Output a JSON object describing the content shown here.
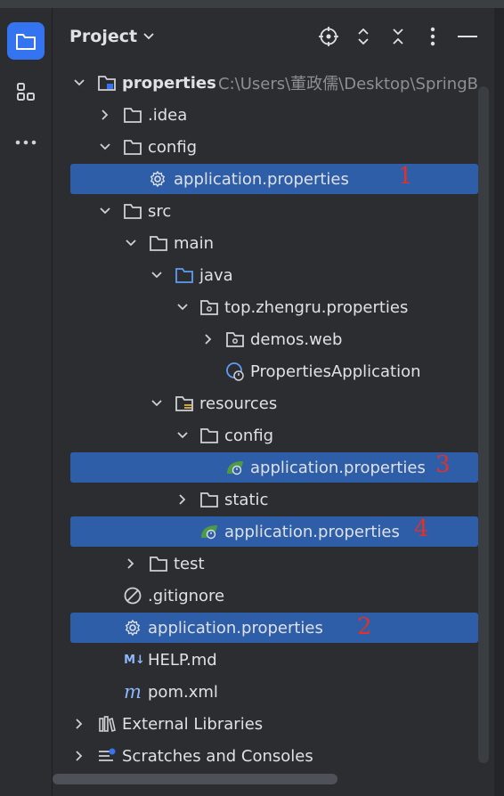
{
  "panel": {
    "title": "Project"
  },
  "tree": {
    "root_label": "properties",
    "root_path": "C:\\Users\\董政儒\\Desktop\\SpringB",
    "idea": ".idea",
    "config": "config",
    "config_app_props": "application.properties",
    "src": "src",
    "main": "main",
    "java": "java",
    "package": "top.zhengru.properties",
    "demos": "demos.web",
    "app_class": "PropertiesApplication",
    "resources": "resources",
    "res_config": "config",
    "res_config_app_props": "application.properties",
    "static": "static",
    "res_app_props": "application.properties",
    "test": "test",
    "gitignore": ".gitignore",
    "root_app_props": "application.properties",
    "help": "HELP.md",
    "pom": "pom.xml",
    "ext_libs": "External Libraries",
    "scratches": "Scratches and Consoles"
  },
  "annotations": {
    "m1": "1",
    "m2": "2",
    "m3": "3",
    "m4": "4"
  },
  "colors": {
    "selection": "#2e5ea8",
    "accent": "#3574f0",
    "annotation": "#e0312b"
  },
  "icons": [
    "folder-icon",
    "structure-icon",
    "more-icon",
    "locate-icon",
    "expand-icon",
    "collapse-icon",
    "options-icon",
    "hide-icon",
    "settings-file-icon",
    "spring-leaf-icon",
    "markdown-icon",
    "maven-icon",
    "libraries-icon",
    "scratches-icon"
  ]
}
